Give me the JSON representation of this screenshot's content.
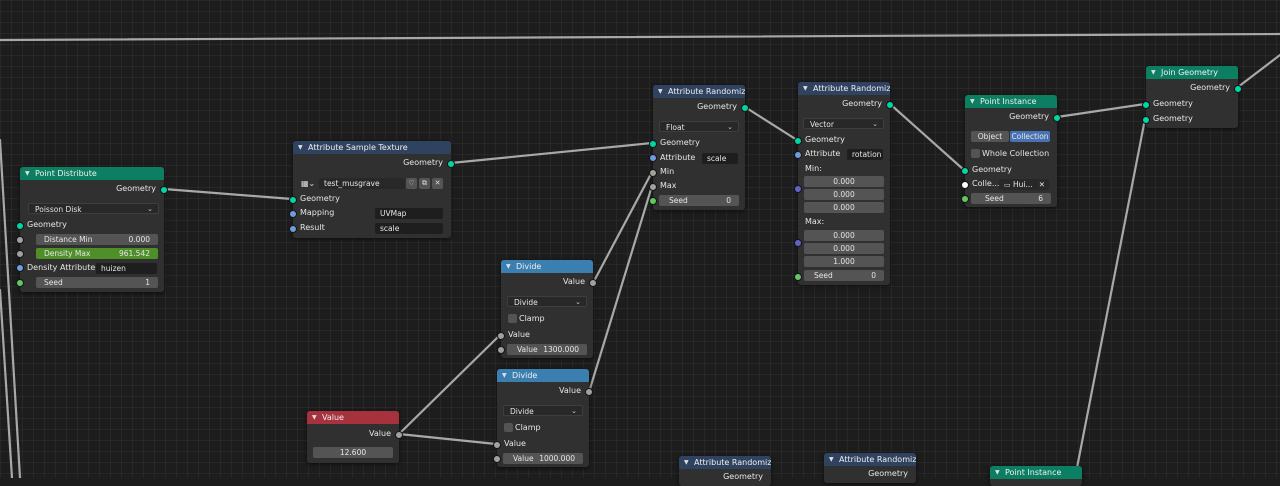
{
  "nodes": {
    "point_distribute": {
      "title": "Point Distribute",
      "out_geometry": "Geometry",
      "method": "Poisson Disk",
      "in_geometry": "Geometry",
      "distance_min_label": "Distance Min",
      "distance_min": "0.000",
      "density_max_label": "Density Max",
      "density_max": "961.542",
      "density_attribute_label": "Density Attribute",
      "density_attribute": "huizen",
      "seed_label": "Seed",
      "seed": "1"
    },
    "attr_sample_texture": {
      "title": "Attribute Sample Texture",
      "out_geometry": "Geometry",
      "texture": "test_musgrave",
      "in_geometry": "Geometry",
      "mapping_label": "Mapping",
      "mapping": "UVMap",
      "result_label": "Result",
      "result": "scale"
    },
    "attr_randomize_1": {
      "title": "Attribute Randomize",
      "out_geometry": "Geometry",
      "type": "Float",
      "in_geometry": "Geometry",
      "attribute_label": "Attribute",
      "attribute": "scale",
      "min_label": "Min",
      "max_label": "Max",
      "seed_label": "Seed",
      "seed": "0"
    },
    "attr_randomize_2": {
      "title": "Attribute Randomize",
      "out_geometry": "Geometry",
      "type": "Vector",
      "in_geometry": "Geometry",
      "attribute_label": "Attribute",
      "attribute": "rotation",
      "min_label": "Min:",
      "min_values": [
        "0.000",
        "0.000",
        "0.000"
      ],
      "max_label": "Max:",
      "max_values": [
        "0.000",
        "0.000",
        "1.000"
      ],
      "seed_label": "Seed",
      "seed": "0"
    },
    "point_instance": {
      "title": "Point Instance",
      "out_geometry": "Geometry",
      "mode_object": "Object",
      "mode_collection": "Collection",
      "whole_collection": "Whole Collection",
      "in_geometry": "Geometry",
      "collection_label": "Colle...",
      "collection": "Hui...",
      "seed_label": "Seed",
      "seed": "6"
    },
    "join_geometry": {
      "title": "Join Geometry",
      "out_geometry": "Geometry",
      "in_geometry_1": "Geometry",
      "in_geometry_2": "Geometry"
    },
    "divide_1": {
      "title": "Divide",
      "out_value": "Value",
      "operation": "Divide",
      "clamp": "Clamp",
      "in_value": "Value",
      "value_label": "Value",
      "value": "1300.000"
    },
    "divide_2": {
      "title": "Divide",
      "out_value": "Value",
      "operation": "Divide",
      "clamp": "Clamp",
      "in_value": "Value",
      "value_label": "Value",
      "value": "1000.000"
    },
    "value_node": {
      "title": "Value",
      "out_value": "Value",
      "value": "12.600"
    },
    "bottom_attr_randomize_1": {
      "title": "Attribute Randomize",
      "out_geometry": "Geometry"
    },
    "bottom_attr_randomize_2": {
      "title": "Attribute Randomize",
      "out_geometry": "Geometry"
    },
    "bottom_point_instance": {
      "title": "Point Instance"
    }
  },
  "colors": {
    "background": "#1d1d1d",
    "geometry_header": "#0c7f63",
    "attribute_header": "#2f4260",
    "converter_header": "#3a7fb0",
    "input_header": "#a5323d",
    "geometry_socket": "#00d6a3",
    "float_socket": "#a1a1a1",
    "int_socket": "#63c763",
    "string_socket": "#6d9de0",
    "vector_socket": "#6363c7",
    "link": "#a8a8a8"
  }
}
